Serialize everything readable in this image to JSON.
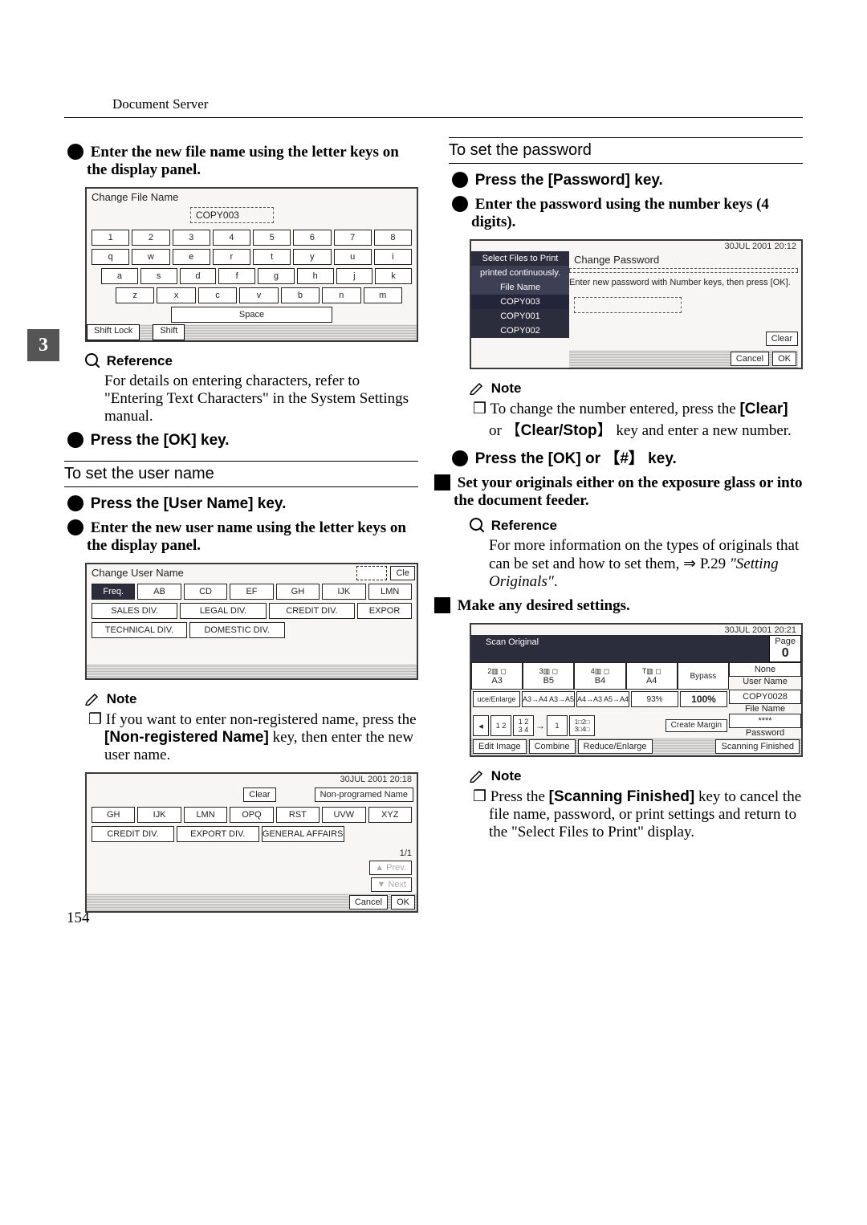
{
  "running_head": "Document Server",
  "page_number": "154",
  "side_tab": "3",
  "left": {
    "step2": "Enter the new file name using the letter keys on the display panel.",
    "panel1": {
      "title": "Change File Name",
      "field": "COPY003",
      "row1": [
        "1",
        "2",
        "3",
        "4",
        "5",
        "6",
        "7",
        "8"
      ],
      "row2": [
        "q",
        "w",
        "e",
        "r",
        "t",
        "y",
        "u",
        "i"
      ],
      "row3": [
        "a",
        "s",
        "d",
        "f",
        "g",
        "h",
        "j",
        "k"
      ],
      "row4": [
        "z",
        "x",
        "c",
        "v",
        "b",
        "n",
        "m"
      ],
      "space": "Space",
      "shiftlock": "Shift Lock",
      "shift": "Shift"
    },
    "reference_label": "Reference",
    "reference_body": "For details on entering characters, refer to \"Entering Text Characters\" in the System Settings manual.",
    "step3": "Press the [OK] key.",
    "username_heading": "To set the user name",
    "u_step1": "Press the [User Name] key.",
    "u_step2": "Enter the new user name using the letter keys on the display panel.",
    "panel2": {
      "title": "Change User Name",
      "cle": "Cle",
      "tabs": [
        "Freq.",
        "AB",
        "CD",
        "EF",
        "GH",
        "IJK",
        "LMN"
      ],
      "row_a": [
        "SALES DIV.",
        "LEGAL DIV.",
        "CREDIT DIV.",
        "EXPOR"
      ],
      "row_b": [
        "TECHNICAL DIV.",
        "DOMESTIC DIV."
      ]
    },
    "note_label": "Note",
    "note_body_a": "If you want to enter non-registered name, press the ",
    "note_key": "[Non-registered Name]",
    "note_body_b": " key, then enter the new user name.",
    "panel3": {
      "time": "30JUL   2001   20:18",
      "clear": "Clear",
      "non_prog": "Non-programed Name",
      "tabs": [
        "GH",
        "IJK",
        "LMN",
        "OPQ",
        "RST",
        "UVW",
        "XYZ"
      ],
      "row": [
        "CREDIT DIV.",
        "EXPORT DIV.",
        "GENERAL AFFAIRS"
      ],
      "pager": "1/1",
      "prev": "▲ Prev.",
      "next": "▼ Next",
      "cancel": "Cancel",
      "ok": "OK"
    }
  },
  "right": {
    "password_heading": "To set the password",
    "p_step1": "Press the [Password] key.",
    "p_step2": "Enter the password using the number keys (4 digits).",
    "panel4": {
      "time": "30JUL   2001   20:12",
      "left_title": "Select Files to Print",
      "left_sub": "printed continuously.",
      "left_col": "File Name",
      "files": [
        "COPY003",
        "COPY001",
        "COPY002"
      ],
      "title": "Change Password",
      "instr": "Enter new password with Number keys, then press [OK].",
      "field": "____________",
      "clear": "Clear",
      "cancel": "Cancel",
      "ok": "OK"
    },
    "note_label": "Note",
    "note_body_a": "To change the number entered, press the ",
    "clear_key": "[Clear]",
    "or": " or ",
    "clearstop": "Clear/Stop",
    "note_body_b": " key and enter a new number.",
    "p_step3_a": "Press the [OK] or ",
    "hash": "#",
    "p_step3_b": " key.",
    "main_step4": "Set your originals either on the exposure glass or into the document feeder.",
    "reference_label": "Reference",
    "reference_body_a": "For more information on the types of originals that can be set and how to set them, ⇒ P.29 ",
    "reference_body_b": "\"Setting Originals\"",
    "reference_body_c": ".",
    "main_step5": "Make any desired settings.",
    "panel5": {
      "time": "30JUL   2001   20:21",
      "scan": "Scan Original",
      "page": "Page",
      "page_val": "0",
      "sizes": [
        "2",
        "A3",
        "3",
        "B5",
        "4",
        "B4",
        "T",
        "A4"
      ],
      "bypass": "Bypass",
      "right_labels": [
        "None",
        "User Name",
        "COPY0028",
        "File Name",
        "****",
        "Password"
      ],
      "row2": [
        "uce/Enlarge",
        "A3→A4 A3→A5",
        "A4→A3 A5→A4",
        "93%",
        "100%"
      ],
      "create_margin": "Create Margin",
      "bottom": [
        "Edit Image",
        "Combine",
        "Reduce/Enlarge"
      ],
      "scan_fin": "Scanning Finished"
    },
    "note2_label": "Note",
    "note2_a": "Press the ",
    "note2_key": "[Scanning Finished]",
    "note2_b": " key to cancel the file name, password, or print settings and return to the \"Select Files to Print\" display."
  }
}
